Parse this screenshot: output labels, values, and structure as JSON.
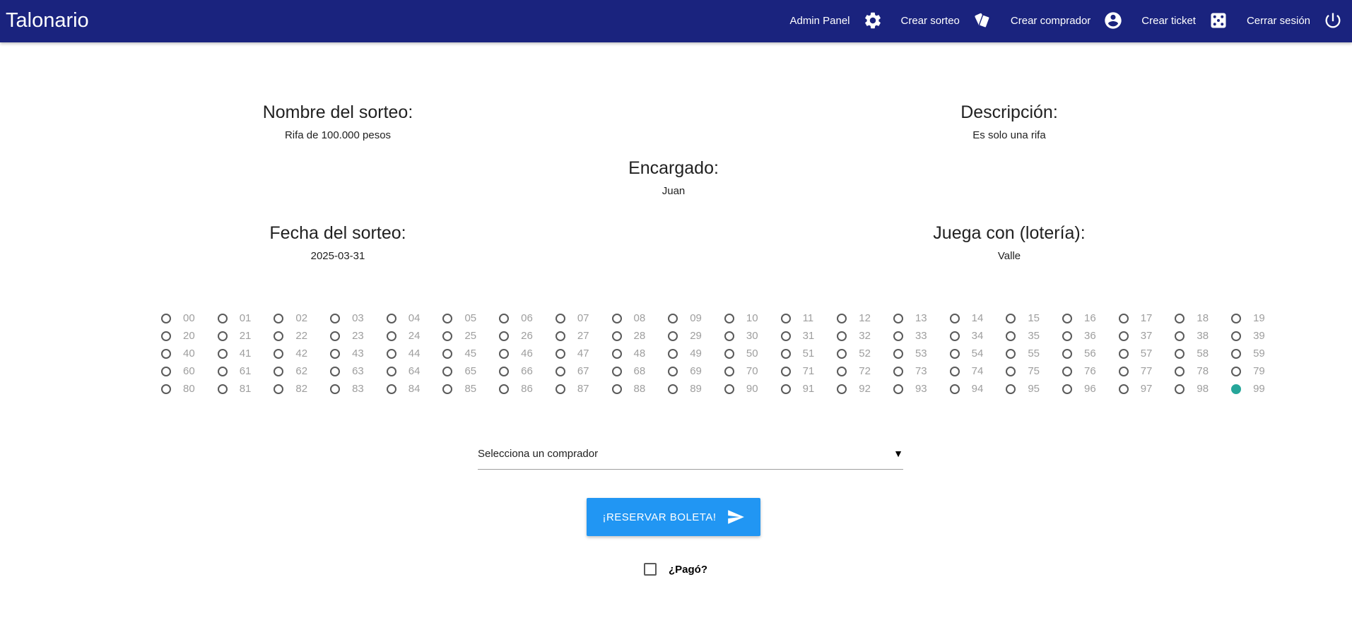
{
  "navbar": {
    "brand": "Talonario",
    "items": [
      {
        "label": "Admin Panel",
        "icon": "gear-icon"
      },
      {
        "label": "Crear sorteo",
        "icon": "tickets-icon"
      },
      {
        "label": "Crear comprador",
        "icon": "account-circle-icon"
      },
      {
        "label": "Crear ticket",
        "icon": "dice-icon"
      },
      {
        "label": "Cerrar sesión",
        "icon": "power-icon"
      }
    ]
  },
  "raffle": {
    "name": {
      "label": "Nombre del sorteo:",
      "value": "Rifa de 100.000 pesos"
    },
    "description": {
      "label": "Descripción:",
      "value": "Es solo una rifa"
    },
    "manager": {
      "label": "Encargado:",
      "value": "Juan"
    },
    "date": {
      "label": "Fecha del sorteo:",
      "value": "2025-03-31"
    },
    "lottery": {
      "label": "Juega con (lotería):",
      "value": "Valle"
    }
  },
  "numbers": {
    "selected": "99",
    "selected_color": "#26a69a",
    "list": [
      "00",
      "01",
      "02",
      "03",
      "04",
      "05",
      "06",
      "07",
      "08",
      "09",
      "10",
      "11",
      "12",
      "13",
      "14",
      "15",
      "16",
      "17",
      "18",
      "19",
      "20",
      "21",
      "22",
      "23",
      "24",
      "25",
      "26",
      "27",
      "28",
      "29",
      "30",
      "31",
      "32",
      "33",
      "34",
      "35",
      "36",
      "37",
      "38",
      "39",
      "40",
      "41",
      "42",
      "43",
      "44",
      "45",
      "46",
      "47",
      "48",
      "49",
      "50",
      "51",
      "52",
      "53",
      "54",
      "55",
      "56",
      "57",
      "58",
      "59",
      "60",
      "61",
      "62",
      "63",
      "64",
      "65",
      "66",
      "67",
      "68",
      "69",
      "70",
      "71",
      "72",
      "73",
      "74",
      "75",
      "76",
      "77",
      "78",
      "79",
      "80",
      "81",
      "82",
      "83",
      "84",
      "85",
      "86",
      "87",
      "88",
      "89",
      "90",
      "91",
      "92",
      "93",
      "94",
      "95",
      "96",
      "97",
      "98",
      "99"
    ]
  },
  "buyer_select": {
    "value": "Selecciona un comprador",
    "caret": "▼"
  },
  "reserve_button": {
    "label": "¡RESERVAR BOLETA!",
    "icon": "send-icon",
    "color": "#2196f3"
  },
  "paid_checkbox": {
    "label": "¿Pagó?",
    "checked": false
  },
  "colors": {
    "navbar": "#1a237e"
  }
}
